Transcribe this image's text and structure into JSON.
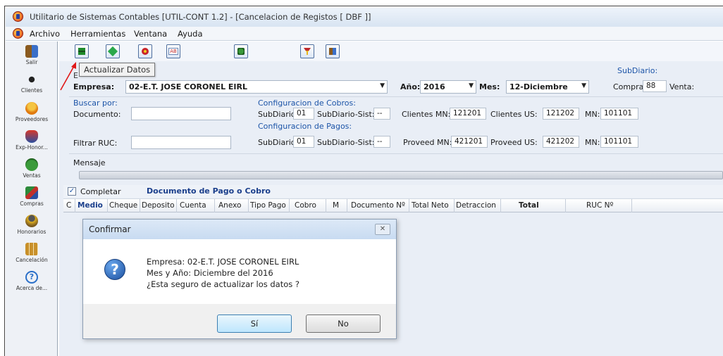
{
  "window": {
    "title": "Utilitario de Sistemas Contables [UTIL-CONT 1.2] - [Cancelacion de Registos [ DBF ]]"
  },
  "menu": [
    {
      "label": "Archivo"
    },
    {
      "label": "Herramientas"
    },
    {
      "label": "Ventana"
    },
    {
      "label": "Ayuda"
    }
  ],
  "sidebar": [
    {
      "label": "Salir",
      "icon": "exit-door-icon"
    },
    {
      "label": "Clientes",
      "icon": "runner-icon"
    },
    {
      "label": "Proveedores",
      "icon": "person-icon"
    },
    {
      "label": "Exp-Honor...",
      "icon": "shield-icon"
    },
    {
      "label": "Ventas",
      "icon": "money-bag-icon"
    },
    {
      "label": "Compras",
      "icon": "shopping-icon"
    },
    {
      "label": "Honorarios",
      "icon": "worker-icon"
    },
    {
      "label": "Cancelación",
      "icon": "grid-icon"
    },
    {
      "label": "Acerca de...",
      "icon": "help-icon"
    }
  ],
  "toolbar": {
    "tooltip": "Actualizar Datos",
    "buttons": [
      {
        "icon": "update-download-icon"
      },
      {
        "icon": "green-diamond-icon"
      },
      {
        "icon": "red-flower-icon"
      },
      {
        "icon": "ab-text-icon"
      },
      {
        "icon": "green-stamp-icon"
      },
      {
        "icon": "filter-icon"
      },
      {
        "icon": "exit-icon"
      }
    ]
  },
  "form": {
    "section_letter": "E",
    "empresa_label": "Empresa:",
    "empresa_value": "02-E.T. JOSE CORONEL EIRL",
    "anio_label": "Año:",
    "anio_value": "2016",
    "mes_label": "Mes:",
    "mes_value": "12-Diciembre",
    "subdiario_label": "SubDiario:",
    "compra_label": "Compra:",
    "compra_value": "88",
    "venta_label": "Venta:",
    "buscar_label": "Buscar por:",
    "documento_label": "Documento:",
    "documento_value": "",
    "filtrar_label": "Filtrar RUC:",
    "filtrar_value": "",
    "mensaje_label": "Mensaje"
  },
  "cobros": {
    "title": "Configuracion de Cobros:",
    "subdiario_label": "SubDiario:",
    "subdiario_value": "01",
    "sist_label": "SubDiario-Sist:",
    "sist_value": "--",
    "mn_label": "Clientes MN:",
    "mn_value": "121201",
    "us_label": "Clientes US:",
    "us_value": "121202",
    "mn2_label": "MN:",
    "mn2_value": "101101"
  },
  "pagos": {
    "title": "Configuracion de Pagos:",
    "subdiario_label": "SubDiario:",
    "subdiario_value": "01",
    "sist_label": "SubDiario-Sist:",
    "sist_value": "--",
    "mn_label": "Proveed MN:",
    "mn_value": "421201",
    "us_label": "Proveed US:",
    "us_value": "421202",
    "mn2_label": "MN:",
    "mn2_value": "101101"
  },
  "grid": {
    "completar_label": "Completar",
    "completar_checked": true,
    "section_title": "Documento de Pago o Cobro",
    "columns": [
      "C",
      "Medio",
      "Cheque",
      "Deposito",
      "Cuenta",
      "Anexo",
      "Tipo Pago",
      "Cobro",
      "M",
      "Documento Nº",
      "Total Neto",
      "Detraccion",
      "Total",
      "RUC Nº"
    ]
  },
  "dialog": {
    "title": "Confirmar",
    "line1": "Empresa: 02-E.T. JOSE CORONEL EIRL",
    "line2": "Mes y Año: Diciembre del 2016",
    "line3": "¿Esta seguro de actualizar los datos ?",
    "yes_label": "Sí",
    "no_label": "No",
    "close_glyph": "✕",
    "question_glyph": "?"
  }
}
